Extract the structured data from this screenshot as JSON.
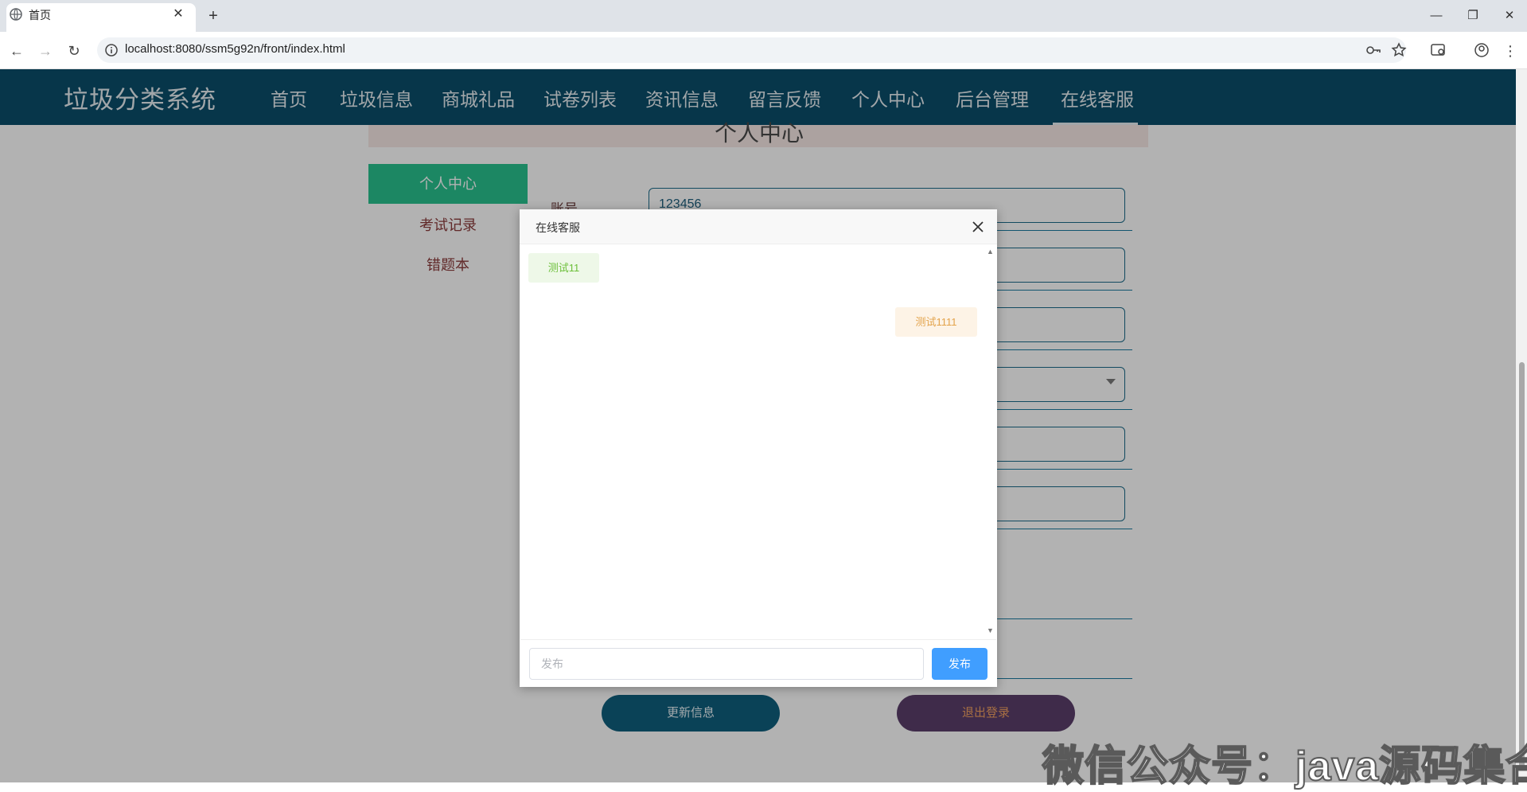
{
  "browser": {
    "tab_title": "首页",
    "url": "localhost:8080/ssm5g92n/front/index.html"
  },
  "site": {
    "logo": "垃圾分类系统",
    "nav": [
      "首页",
      "垃圾信息",
      "商城礼品",
      "试卷列表",
      "资讯信息",
      "留言反馈",
      "个人中心",
      "后台管理",
      "在线客服"
    ],
    "active_nav": "在线客服"
  },
  "personal": {
    "title": "个人中心",
    "sidebar": [
      "个人中心",
      "考试记录",
      "错题本"
    ],
    "active_sidebar": "个人中心",
    "account_label": "账号",
    "account_value": "123456",
    "update_button": "更新信息",
    "logout_button": "退出登录"
  },
  "dialog": {
    "title": "在线客服",
    "messages": [
      {
        "side": "left",
        "text": "测试11"
      },
      {
        "side": "right",
        "text": "测试1111"
      }
    ],
    "input_placeholder": "发布",
    "send_button": "发布"
  },
  "watermark": "微信公众号：java源码集合",
  "colors": {
    "header_bg": "#0b4e6a",
    "sidebar_active": "#29c28f",
    "send_button": "#409eff",
    "left_bubble": "#eef8e8",
    "right_bubble": "#fdf3e6"
  }
}
